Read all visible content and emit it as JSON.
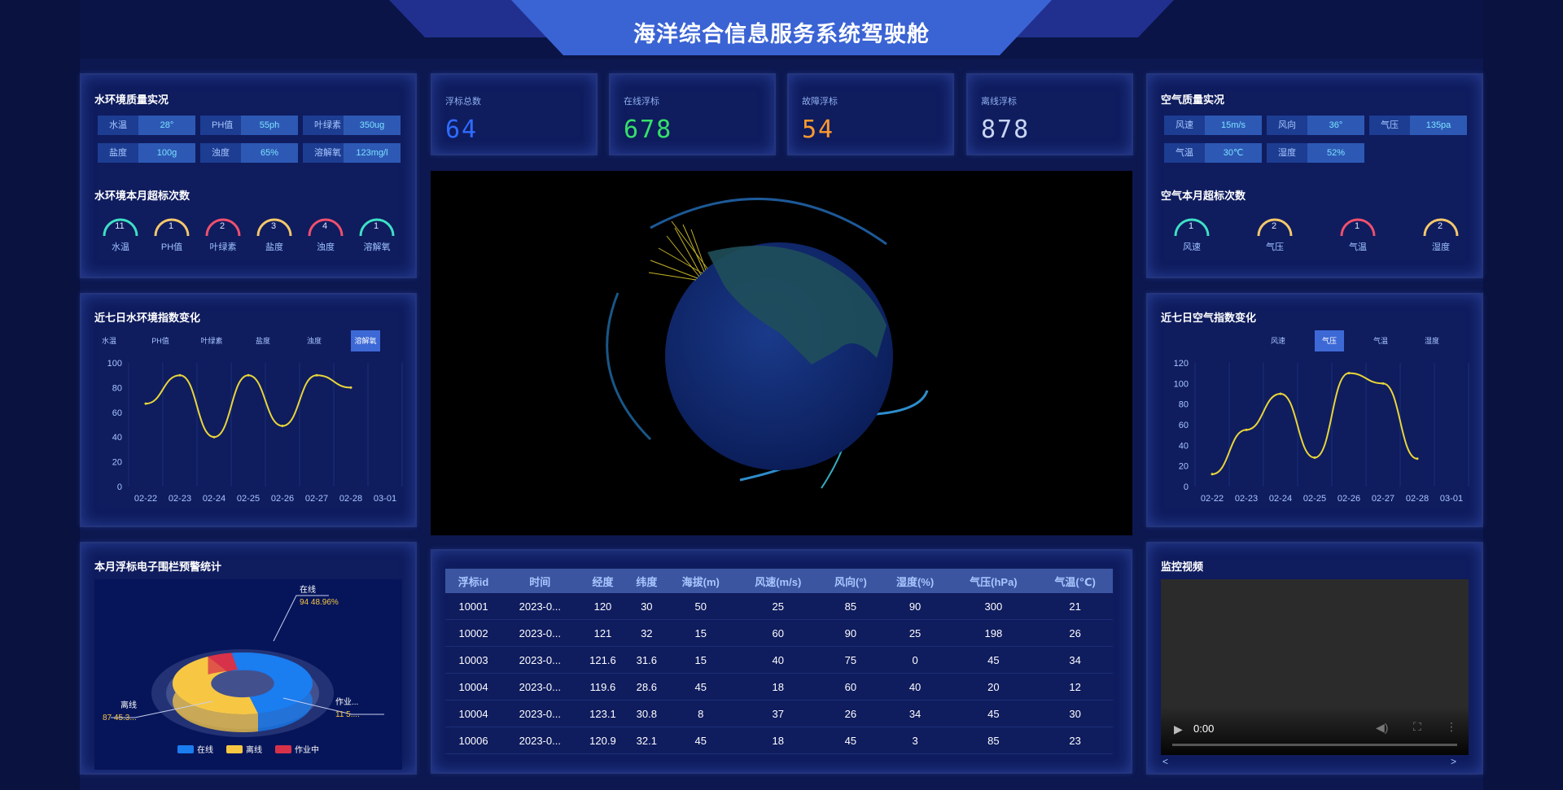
{
  "header": {
    "title": "海洋综合信息服务系统驾驶舱"
  },
  "water_quality": {
    "title": "水环境质量实况",
    "items": [
      {
        "label": "水温",
        "value": "28°"
      },
      {
        "label": "PH值",
        "value": "55ph"
      },
      {
        "label": "叶绿素",
        "value": "350ug"
      },
      {
        "label": "盐度",
        "value": "100g"
      },
      {
        "label": "浊度",
        "value": "65%"
      },
      {
        "label": "溶解氧",
        "value": "123mg/l"
      }
    ],
    "exceed_title": "水环境本月超标次数",
    "exceed": [
      {
        "label": "水温",
        "value": "11",
        "color": "#3fe0c5"
      },
      {
        "label": "PH值",
        "value": "1",
        "color": "#f5c86b"
      },
      {
        "label": "叶绿素",
        "value": "2",
        "color": "#f0506e"
      },
      {
        "label": "盐度",
        "value": "3",
        "color": "#f5c86b"
      },
      {
        "label": "浊度",
        "value": "4",
        "color": "#f0506e"
      },
      {
        "label": "溶解氧",
        "value": "1",
        "color": "#3fe0c5"
      }
    ]
  },
  "stats": [
    {
      "label": "浮标总数",
      "value": "64",
      "color": "#2f6bff"
    },
    {
      "label": "在线浮标",
      "value": "678",
      "color": "#35e06a"
    },
    {
      "label": "故障浮标",
      "value": "54",
      "color": "#ff9a2e"
    },
    {
      "label": "离线浮标",
      "value": "878",
      "color": "#c9d4f2"
    }
  ],
  "air_quality": {
    "title": "空气质量实况",
    "items": [
      {
        "label": "风速",
        "value": "15m/s"
      },
      {
        "label": "风向",
        "value": "36°"
      },
      {
        "label": "气压",
        "value": "135pa"
      },
      {
        "label": "气温",
        "value": "30℃"
      },
      {
        "label": "湿度",
        "value": "52%"
      }
    ],
    "exceed_title": "空气本月超标次数",
    "exceed": [
      {
        "label": "风速",
        "value": "1",
        "color": "#3fe0c5"
      },
      {
        "label": "气压",
        "value": "2",
        "color": "#f5c86b"
      },
      {
        "label": "气温",
        "value": "1",
        "color": "#f0506e"
      },
      {
        "label": "湿度",
        "value": "2",
        "color": "#f5c86b"
      }
    ]
  },
  "water_chart": {
    "title": "近七日水环境指数变化",
    "tabs": [
      "水温",
      "PH值",
      "叶绿素",
      "盐度",
      "浊度",
      "溶解氧"
    ],
    "active_tab": 5
  },
  "air_chart": {
    "title": "近七日空气指数变化",
    "tabs": [
      "风速",
      "气压",
      "气温",
      "湿度"
    ],
    "active_tab": 1
  },
  "chart_data": [
    {
      "type": "line",
      "categories": [
        "02-22",
        "02-23",
        "02-24",
        "02-25",
        "02-26",
        "02-27",
        "02-28",
        "03-01"
      ],
      "values": [
        67,
        90,
        40,
        90,
        49,
        90,
        80
      ],
      "y_ticks": [
        "0",
        "20",
        "40",
        "60",
        "80",
        "100"
      ],
      "ylim": [
        0,
        100
      ],
      "line_color": "#e8d63a"
    },
    {
      "type": "line",
      "categories": [
        "02-22",
        "02-23",
        "02-24",
        "02-25",
        "02-26",
        "02-27",
        "02-28",
        "03-01"
      ],
      "values": [
        12,
        55,
        90,
        28,
        110,
        100,
        27
      ],
      "y_ticks": [
        "0",
        "20",
        "40",
        "60",
        "80",
        "100",
        "120"
      ],
      "ylim": [
        0,
        120
      ],
      "line_color": "#e8d63a"
    },
    {
      "type": "pie",
      "categories": [
        "在线",
        "离线",
        "作业中"
      ],
      "values": [
        94,
        87,
        11
      ],
      "labels": [
        "94 48.96%",
        "87 45.3...",
        "11 5...."
      ],
      "callout_names": [
        "在线",
        "离线",
        "作业..."
      ],
      "colors": [
        "#1a7df0",
        "#f7c744",
        "#d8324a"
      ]
    }
  ],
  "fence": {
    "title": "本月浮标电子围栏预警统计"
  },
  "table": {
    "headers": [
      "浮标id",
      "时间",
      "经度",
      "纬度",
      "海拔(m)",
      "风速(m/s)",
      "风向(°)",
      "湿度(%)",
      "气压(hPa)",
      "气温(℃)"
    ],
    "rows": [
      [
        "10001",
        "2023-0...",
        "120",
        "30",
        "50",
        "25",
        "85",
        "90",
        "300",
        "21"
      ],
      [
        "10002",
        "2023-0...",
        "121",
        "32",
        "15",
        "60",
        "90",
        "25",
        "198",
        "26"
      ],
      [
        "10003",
        "2023-0...",
        "121.6",
        "31.6",
        "15",
        "40",
        "75",
        "0",
        "45",
        "34"
      ],
      [
        "10004",
        "2023-0...",
        "119.6",
        "28.6",
        "45",
        "18",
        "60",
        "40",
        "20",
        "12"
      ],
      [
        "10004",
        "2023-0...",
        "123.1",
        "30.8",
        "8",
        "37",
        "26",
        "34",
        "45",
        "30"
      ],
      [
        "10006",
        "2023-0...",
        "120.9",
        "32.1",
        "45",
        "18",
        "45",
        "3",
        "85",
        "23"
      ]
    ]
  },
  "video": {
    "title": "监控视频",
    "time": "0:00",
    "prev": "<",
    "next": ">"
  }
}
